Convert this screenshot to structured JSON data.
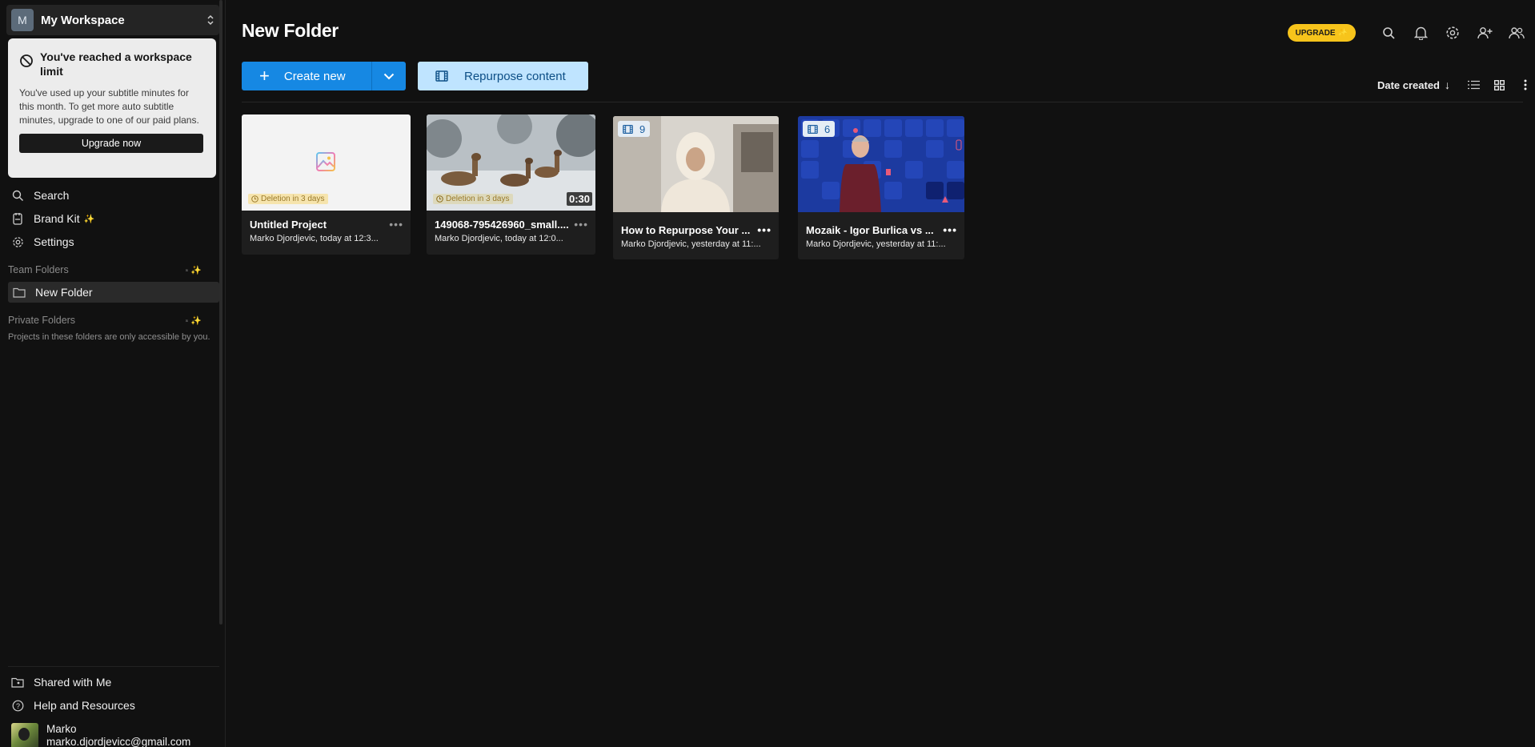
{
  "workspace": {
    "avatar_letter": "M",
    "name": "My Workspace"
  },
  "limit_card": {
    "title": "You've reached a workspace limit",
    "body": "You've used up your subtitle minutes for this month. To get more auto subtitle minutes, upgrade to one of our paid plans.",
    "button": "Upgrade now"
  },
  "nav": {
    "search": "Search",
    "brand_kit": "Brand Kit",
    "settings": "Settings"
  },
  "team_folders": {
    "label": "Team Folders",
    "items": [
      "New Folder"
    ]
  },
  "private_folders": {
    "label": "Private Folders",
    "note": "Projects in these folders are only accessible by you."
  },
  "footer_nav": {
    "shared": "Shared with Me",
    "help": "Help and Resources"
  },
  "user": {
    "name": "Marko",
    "email": "marko.djordjevicc@gmail.com"
  },
  "page_title": "New Folder",
  "topbar": {
    "upgrade": "UPGRADE"
  },
  "actions": {
    "create_new": "Create new",
    "repurpose": "Repurpose content"
  },
  "sort": {
    "label": "Date created"
  },
  "cards": [
    {
      "title": "Untitled Project",
      "subtitle": "Marko Djordjevic, today at 12:3...",
      "badge": "Deletion in 3 days"
    },
    {
      "title": "149068-795426960_small....",
      "subtitle": "Marko Djordjevic, today at 12:0...",
      "badge": "Deletion in 3 days",
      "duration": "0:30"
    },
    {
      "title": "How to Repurpose Your ...",
      "subtitle": "Marko Djordjevic, yesterday at 11:...",
      "clips": "9"
    },
    {
      "title": "Mozaik - Igor Burlica vs ...",
      "subtitle": "Marko Djordjevic, yesterday at 11:...",
      "clips": "6"
    }
  ],
  "colors": {
    "accent": "#1688e3",
    "upgrade": "#f7c41b",
    "background": "#111111"
  }
}
